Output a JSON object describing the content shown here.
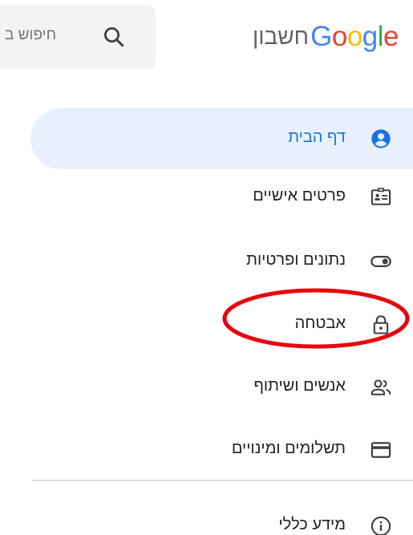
{
  "header": {
    "logo": {
      "text": "Google",
      "letters": [
        {
          "char": "G",
          "color": "#4285F4"
        },
        {
          "char": "o",
          "color": "#EA4335"
        },
        {
          "char": "o",
          "color": "#FBBC05"
        },
        {
          "char": "g",
          "color": "#4285F4"
        },
        {
          "char": "l",
          "color": "#34A853"
        },
        {
          "char": "e",
          "color": "#EA4335"
        }
      ]
    },
    "product_label": "חשבון",
    "search": {
      "placeholder": "חיפוש ב",
      "icon": "search-icon"
    }
  },
  "nav": {
    "items": [
      {
        "label": "דף הבית",
        "icon": "account-circle-icon",
        "active": true
      },
      {
        "label": "פרטים אישיים",
        "icon": "id-card-icon",
        "active": false
      },
      {
        "label": "נתונים ופרטיות",
        "icon": "toggle-icon",
        "active": false
      },
      {
        "label": "אבטחה",
        "icon": "lock-icon",
        "active": false
      },
      {
        "label": "אנשים ושיתוף",
        "icon": "people-icon",
        "active": false
      },
      {
        "label": "תשלומים ומינויים",
        "icon": "credit-card-icon",
        "active": false
      }
    ],
    "footer_items": [
      {
        "label": "מידע כללי",
        "icon": "info-icon",
        "active": false
      }
    ]
  },
  "colors": {
    "active_bg": "#e8f0fe",
    "active_fg": "#1a73e8",
    "text": "#202124",
    "icon": "#5f6368",
    "annotation": "#e8000b"
  }
}
